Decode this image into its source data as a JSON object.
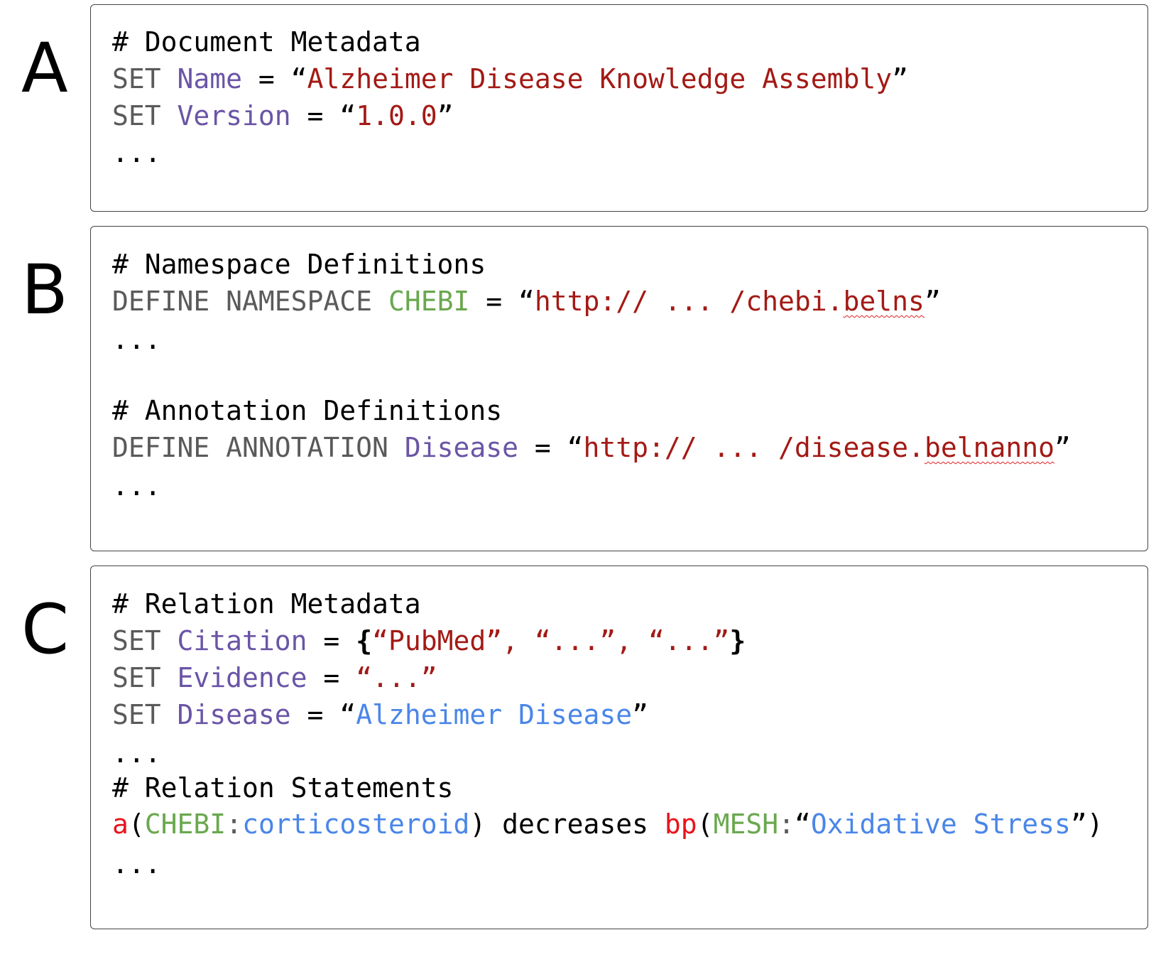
{
  "panels": {
    "a": {
      "letter": "A",
      "header": "# Document Metadata",
      "lines": [
        {
          "kw": "SET ",
          "key": "Name",
          "op": " = ",
          "q1": "“",
          "val": "Alzheimer Disease Knowledge Assembly",
          "q2": "”"
        },
        {
          "kw": "SET ",
          "key": "Version",
          "op": " = ",
          "q1": "“",
          "val": "1.0.0",
          "q2": "”"
        }
      ],
      "ellipsis": "..."
    },
    "b": {
      "letter": "B",
      "ns_header": "# Namespace Definitions",
      "ns_line": {
        "kw": "DEFINE NAMESPACE ",
        "key": "CHEBI",
        "op": " = ",
        "q1": "“",
        "val_pre": "http:// ... /chebi.",
        "val_sq": "belns",
        "q2": "”"
      },
      "ns_ellipsis": "...",
      "an_header": "# Annotation Definitions",
      "an_line": {
        "kw": "DEFINE ANNOTATION ",
        "key": "Disease",
        "op": " = ",
        "q1": "“",
        "val_pre": "http:// ... /disease.",
        "val_sq": "belnanno",
        "q2": "”"
      },
      "an_ellipsis": "..."
    },
    "c": {
      "letter": "C",
      "header": "# Relation Metadata",
      "citation": {
        "kw": "SET ",
        "key": "Citation",
        "op": " = ",
        "open": "{",
        "val": "“PubMed”, “...”, “...”",
        "close": "}"
      },
      "evidence": {
        "kw": "SET ",
        "key": "Evidence",
        "op": " = ",
        "val": "“...”"
      },
      "disease": {
        "kw": "SET ",
        "key": "Disease",
        "op": " = ",
        "q1": "“",
        "val": "Alzheimer Disease",
        "q2": "”"
      },
      "ellipsis1": "...",
      "stmt_header": "# Relation Statements",
      "stmt": {
        "fn1": "a",
        "p1": "(",
        "ns1": "CHEBI",
        "colon1": ":",
        "term1": "corticosteroid",
        "p2": ") ",
        "rel": "decreases ",
        "fn2": "bp",
        "p3": "(",
        "ns2": "MESH",
        "colon2": ":",
        "q1": "“",
        "term2": "Oxidative Stress",
        "q2": "”",
        "p4": ")"
      },
      "ellipsis2": "..."
    }
  },
  "colors": {
    "keyword": "#5a5a5a",
    "identifier": "#6a55a6",
    "string": "#a31a15",
    "namespace": "#6aa84f",
    "term": "#4a86e8",
    "function": "#e8141c"
  }
}
